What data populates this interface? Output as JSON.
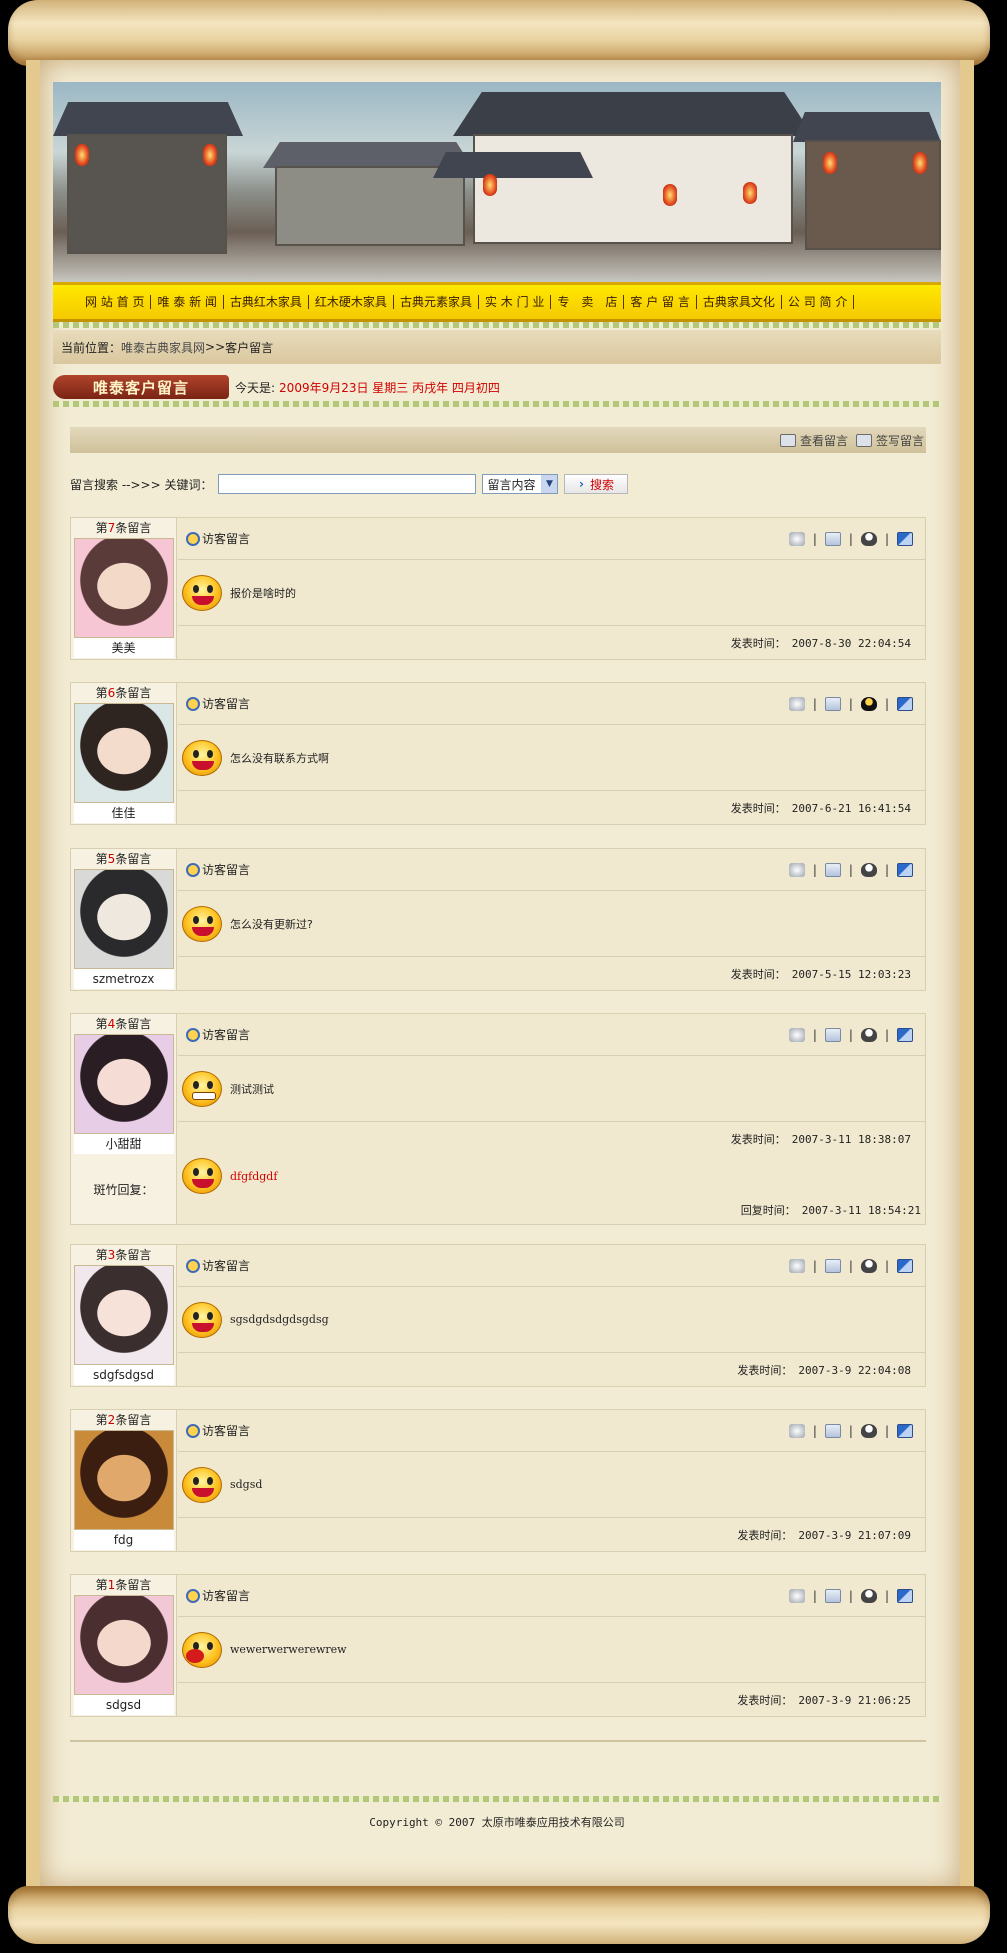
{
  "nav": {
    "items": [
      "网 站 首 页",
      "唯 泰 新 闻",
      "古典红木家具",
      "红木硬木家具",
      "古典元素家具",
      "实 木 门 业",
      "专　卖　店",
      "客 户 留 言",
      "古典家具文化",
      "公 司 简 介"
    ]
  },
  "breadcrumb": {
    "label": "当前位置：",
    "site": "唯泰古典家具网",
    "sep": ">>",
    "current": "客户留言"
  },
  "section": {
    "title": "唯泰客户留言",
    "today_label": "今天是:",
    "today_value": "2009年9月23日  星期三  丙戌年  四月初四"
  },
  "actions": {
    "view": "查看留言",
    "write": "签写留言"
  },
  "search": {
    "label": "留言搜索 -->>> 关键词：",
    "input_value": "",
    "select_value": "留言内容",
    "button": "搜索"
  },
  "messages": [
    {
      "prefix": "第",
      "num": "7",
      "suffix": "条留言",
      "name": "美美",
      "type": "访客留言",
      "content": "报价是啥时的",
      "time_label": "发表时间：",
      "time": "2007-8-30 22:04:54",
      "avatar_colors": [
        "#f7c6d5",
        "#5a3b3a",
        "#f3d9c8"
      ],
      "face": "smile",
      "qq_active": false
    },
    {
      "prefix": "第",
      "num": "6",
      "suffix": "条留言",
      "name": "佳佳",
      "type": "访客留言",
      "content": "怎么没有联系方式啊",
      "time_label": "发表时间：",
      "time": "2007-6-21 16:41:54",
      "avatar_colors": [
        "#dbe6e6",
        "#2e2420",
        "#f4dccc"
      ],
      "face": "smile",
      "qq_active": true
    },
    {
      "prefix": "第",
      "num": "5",
      "suffix": "条留言",
      "name": "szmetrozx",
      "type": "访客留言",
      "content": "怎么没有更新过?",
      "time_label": "发表时间：",
      "time": "2007-5-15 12:03:23",
      "avatar_colors": [
        "#d9dad7",
        "#2a2a2c",
        "#efe8de"
      ],
      "face": "smile",
      "qq_active": false
    },
    {
      "prefix": "第",
      "num": "4",
      "suffix": "条留言",
      "name": "小甜甜",
      "type": "访客留言",
      "content": "测试测试",
      "time_label": "发表时间：",
      "time": "2007-3-11 18:38:07",
      "avatar_colors": [
        "#e8cde6",
        "#2a1e24",
        "#f5ddd5"
      ],
      "face": "grim",
      "qq_active": false
    },
    {
      "prefix": "第",
      "num": "3",
      "suffix": "条留言",
      "name": "sdgfsdgsd",
      "type": "访客留言",
      "content": "sgsdgdsdgdsgdsg",
      "time_label": "发表时间：",
      "time": "2007-3-9 22:04:08",
      "avatar_colors": [
        "#f0e8ec",
        "#3a2e2e",
        "#f7e2da"
      ],
      "face": "smile",
      "qq_active": false
    },
    {
      "prefix": "第",
      "num": "2",
      "suffix": "条留言",
      "name": "fdg",
      "type": "访客留言",
      "content": "sdgsd",
      "time_label": "发表时间：",
      "time": "2007-3-9 21:07:09",
      "avatar_colors": [
        "#c98b3a",
        "#3b1e10",
        "#e0a86a"
      ],
      "face": "smile",
      "qq_active": false
    },
    {
      "prefix": "第",
      "num": "1",
      "suffix": "条留言",
      "name": "sdgsd",
      "type": "访客留言",
      "content": "wewerwerwerewrew",
      "time_label": "发表时间：",
      "time": "2007-3-9 21:06:25",
      "avatar_colors": [
        "#f3c8d6",
        "#4a2e30",
        "#f4d8cc"
      ],
      "face": "shout",
      "qq_active": false
    }
  ],
  "reply": {
    "label": "斑竹回复：",
    "content": "dfgfdgdf",
    "time_label": "回复时间：",
    "time": "2007-3-11 18:54:21"
  },
  "footer": {
    "copyright": "Copyright © 2007 太原市唯泰应用技术有限公司"
  }
}
